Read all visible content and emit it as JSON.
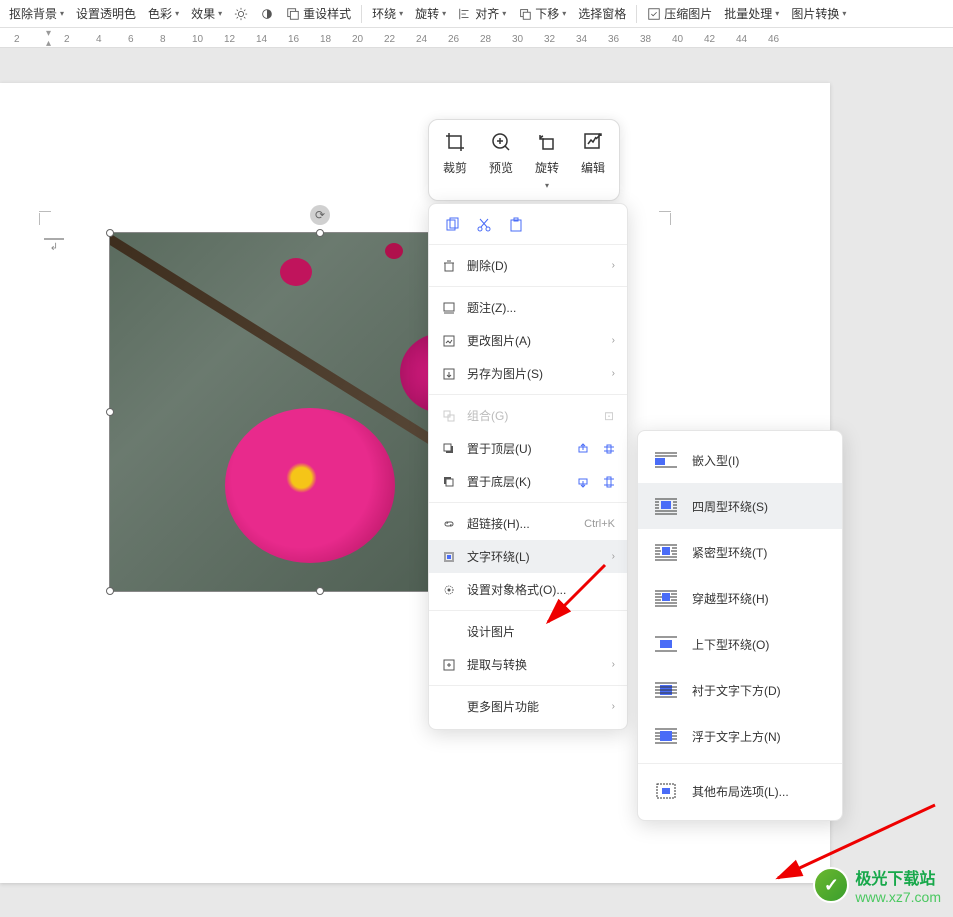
{
  "toolbar": {
    "remove_bg": "抠除背景",
    "set_transparent": "设置透明色",
    "color": "色彩",
    "effect": "效果",
    "reset_style": "重设样式",
    "wrap": "环绕",
    "rotate": "旋转",
    "align": "对齐",
    "send_down": "下移",
    "select_pane": "选择窗格",
    "compress": "压缩图片",
    "batch": "批量处理",
    "convert": "图片转换"
  },
  "ruler_ticks": [
    "2",
    "2",
    "4",
    "6",
    "8",
    "10",
    "12",
    "14",
    "16",
    "18",
    "20",
    "22",
    "24",
    "26",
    "28",
    "30",
    "32",
    "34",
    "36",
    "38",
    "40",
    "42",
    "44",
    "46"
  ],
  "float_tools": {
    "crop": "裁剪",
    "preview": "预览",
    "rotate": "旋转",
    "edit": "编辑"
  },
  "ctx": {
    "delete": "删除(D)",
    "caption": "题注(Z)...",
    "change_pic": "更改图片(A)",
    "save_as_pic": "另存为图片(S)",
    "group": "组合(G)",
    "bring_front": "置于顶层(U)",
    "send_back": "置于底层(K)",
    "hyperlink": "超链接(H)...",
    "hyperlink_shortcut": "Ctrl+K",
    "text_wrap": "文字环绕(L)",
    "format_obj": "设置对象格式(O)...",
    "design_pic": "设计图片",
    "extract_convert": "提取与转换",
    "more_pic": "更多图片功能"
  },
  "wrap_sub": {
    "inline": "嵌入型(I)",
    "square": "四周型环绕(S)",
    "tight": "紧密型环绕(T)",
    "through": "穿越型环绕(H)",
    "top_bottom": "上下型环绕(O)",
    "behind": "衬于文字下方(D)",
    "front": "浮于文字上方(N)",
    "more_layout": "其他布局选项(L)..."
  },
  "watermark": {
    "line1": "极光下载站",
    "line2": "www.xz7.com"
  }
}
